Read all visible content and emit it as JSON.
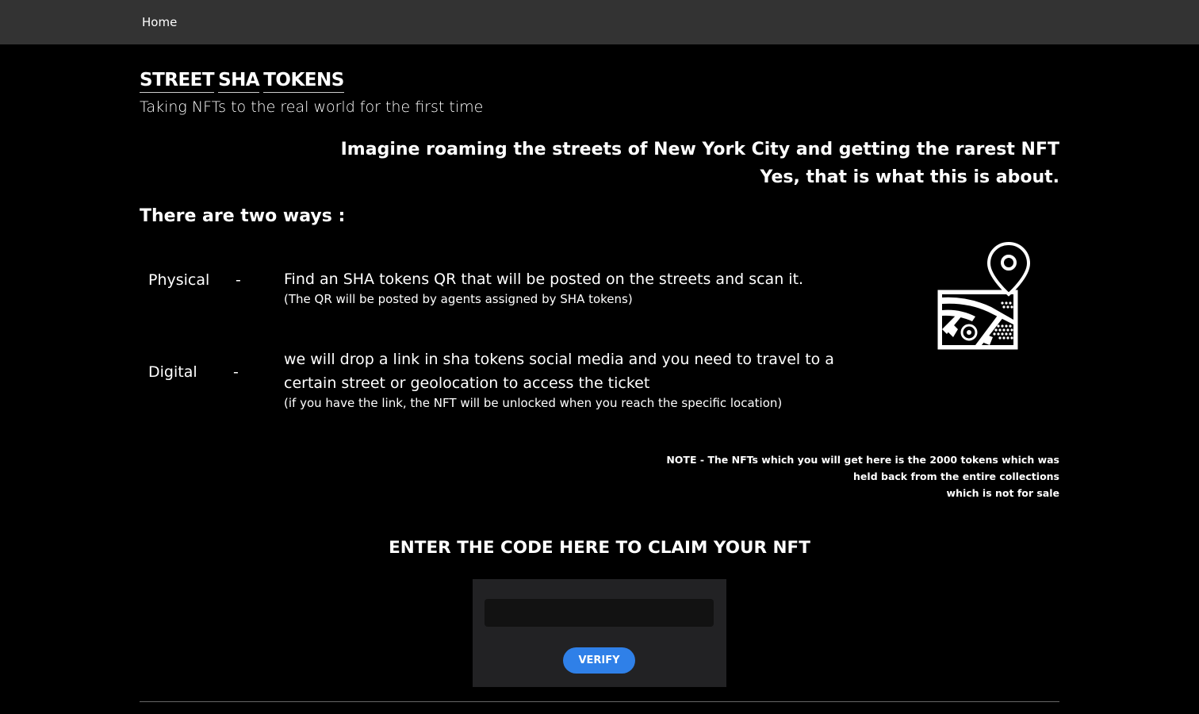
{
  "nav": {
    "home_label": "Home"
  },
  "brand": {
    "words": [
      "STREET",
      "SHA",
      "TOKENS"
    ]
  },
  "tagline": "Taking NFTs to the real world for the first time",
  "intro": {
    "line1": "Imagine roaming the streets of New York City and getting the rarest NFT",
    "line2": "Yes, that is what this is about."
  },
  "ways_heading": "There are two ways :",
  "ways": [
    {
      "label": "Physical",
      "dash": "-",
      "text": "Find an SHA tokens QR that will be posted on the streets and scan it.",
      "note": "(The QR will be posted by agents assigned by SHA tokens)"
    },
    {
      "label": "Digital",
      "dash": "-",
      "text": "we will drop a link in sha tokens social media and you need to travel to a certain street or geolocation to access the ticket",
      "note": "(if you have the link, the NFT will be unlocked when you reach the specific location)"
    }
  ],
  "map_icon": "map-location-pin-icon",
  "note": {
    "line1": "NOTE - The NFTs which you will get here is the 2000 tokens which was",
    "line2": "held back from the entire collections",
    "line3": "which is not for sale"
  },
  "claim": {
    "heading": "ENTER THE CODE HERE TO CLAIM YOUR NFT",
    "input_value": "",
    "input_placeholder": "",
    "verify_label": "VERIFY"
  },
  "colors": {
    "navbar": "#333333",
    "background": "#000000",
    "claim_box": "#222224",
    "verify_button": "#2f80e8"
  }
}
